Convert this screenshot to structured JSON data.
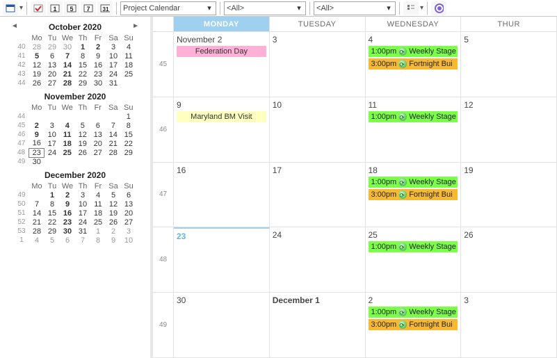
{
  "toolbar": {
    "calendar_combo": "Project Calendar",
    "filter1": "<All>",
    "filter2": "<All>"
  },
  "mini_calendars": [
    {
      "title": "October 2020",
      "show_nav": true,
      "dow": [
        "Mo",
        "Tu",
        "We",
        "Th",
        "Fr",
        "Sa",
        "Su"
      ],
      "weeks": [
        {
          "wk": "40",
          "days": [
            {
              "n": "28",
              "dim": true
            },
            {
              "n": "29",
              "dim": true
            },
            {
              "n": "30",
              "dim": true
            },
            {
              "n": "1",
              "bold": true
            },
            {
              "n": "2",
              "bold": true
            },
            {
              "n": "3"
            },
            {
              "n": "4"
            }
          ]
        },
        {
          "wk": "41",
          "days": [
            {
              "n": "5",
              "bold": true
            },
            {
              "n": "6"
            },
            {
              "n": "7",
              "bold": true
            },
            {
              "n": "8"
            },
            {
              "n": "9"
            },
            {
              "n": "10"
            },
            {
              "n": "11"
            }
          ]
        },
        {
          "wk": "42",
          "days": [
            {
              "n": "12"
            },
            {
              "n": "13"
            },
            {
              "n": "14",
              "bold": true
            },
            {
              "n": "15"
            },
            {
              "n": "16"
            },
            {
              "n": "17"
            },
            {
              "n": "18"
            }
          ]
        },
        {
          "wk": "43",
          "days": [
            {
              "n": "19"
            },
            {
              "n": "20"
            },
            {
              "n": "21",
              "bold": true
            },
            {
              "n": "22"
            },
            {
              "n": "23"
            },
            {
              "n": "24"
            },
            {
              "n": "25"
            }
          ]
        },
        {
          "wk": "44",
          "days": [
            {
              "n": "26"
            },
            {
              "n": "27"
            },
            {
              "n": "28",
              "bold": true
            },
            {
              "n": "29"
            },
            {
              "n": "30"
            },
            {
              "n": "31"
            },
            {
              "n": ""
            }
          ]
        }
      ]
    },
    {
      "title": "November 2020",
      "show_nav": false,
      "dow": [
        "Mo",
        "Tu",
        "We",
        "Th",
        "Fr",
        "Sa",
        "Su"
      ],
      "weeks": [
        {
          "wk": "44",
          "days": [
            {
              "n": ""
            },
            {
              "n": ""
            },
            {
              "n": ""
            },
            {
              "n": ""
            },
            {
              "n": ""
            },
            {
              "n": ""
            },
            {
              "n": "1"
            }
          ]
        },
        {
          "wk": "45",
          "days": [
            {
              "n": "2",
              "bold": true
            },
            {
              "n": "3"
            },
            {
              "n": "4",
              "bold": true
            },
            {
              "n": "5"
            },
            {
              "n": "6"
            },
            {
              "n": "7"
            },
            {
              "n": "8"
            }
          ]
        },
        {
          "wk": "46",
          "days": [
            {
              "n": "9",
              "bold": true
            },
            {
              "n": "10"
            },
            {
              "n": "11",
              "bold": true
            },
            {
              "n": "12"
            },
            {
              "n": "13"
            },
            {
              "n": "14"
            },
            {
              "n": "15"
            }
          ]
        },
        {
          "wk": "47",
          "days": [
            {
              "n": "16"
            },
            {
              "n": "17"
            },
            {
              "n": "18",
              "bold": true
            },
            {
              "n": "19"
            },
            {
              "n": "20"
            },
            {
              "n": "21"
            },
            {
              "n": "22"
            }
          ]
        },
        {
          "wk": "48",
          "days": [
            {
              "n": "23",
              "today": true
            },
            {
              "n": "24"
            },
            {
              "n": "25",
              "bold": true
            },
            {
              "n": "26"
            },
            {
              "n": "27"
            },
            {
              "n": "28"
            },
            {
              "n": "29"
            }
          ]
        },
        {
          "wk": "49",
          "days": [
            {
              "n": "30"
            },
            {
              "n": ""
            },
            {
              "n": ""
            },
            {
              "n": ""
            },
            {
              "n": ""
            },
            {
              "n": ""
            },
            {
              "n": ""
            }
          ]
        }
      ]
    },
    {
      "title": "December 2020",
      "show_nav": false,
      "dow": [
        "Mo",
        "Tu",
        "We",
        "Th",
        "Fr",
        "Sa",
        "Su"
      ],
      "weeks": [
        {
          "wk": "49",
          "days": [
            {
              "n": ""
            },
            {
              "n": "1",
              "bold": true
            },
            {
              "n": "2",
              "bold": true
            },
            {
              "n": "3"
            },
            {
              "n": "4"
            },
            {
              "n": "5"
            },
            {
              "n": "6"
            }
          ]
        },
        {
          "wk": "50",
          "days": [
            {
              "n": "7"
            },
            {
              "n": "8"
            },
            {
              "n": "9",
              "bold": true
            },
            {
              "n": "10"
            },
            {
              "n": "11"
            },
            {
              "n": "12"
            },
            {
              "n": "13"
            }
          ]
        },
        {
          "wk": "51",
          "days": [
            {
              "n": "14"
            },
            {
              "n": "15"
            },
            {
              "n": "16",
              "bold": true
            },
            {
              "n": "17"
            },
            {
              "n": "18"
            },
            {
              "n": "19"
            },
            {
              "n": "20"
            }
          ]
        },
        {
          "wk": "52",
          "days": [
            {
              "n": "21"
            },
            {
              "n": "22"
            },
            {
              "n": "23",
              "bold": true
            },
            {
              "n": "24"
            },
            {
              "n": "25"
            },
            {
              "n": "26"
            },
            {
              "n": "27"
            }
          ]
        },
        {
          "wk": "53",
          "days": [
            {
              "n": "28"
            },
            {
              "n": "29"
            },
            {
              "n": "30",
              "bold": true
            },
            {
              "n": "31"
            },
            {
              "n": "1",
              "dim": true
            },
            {
              "n": "2",
              "dim": true
            },
            {
              "n": "3",
              "dim": true
            }
          ]
        },
        {
          "wk": "1",
          "days": [
            {
              "n": "4",
              "dim": true
            },
            {
              "n": "5",
              "dim": true
            },
            {
              "n": "6",
              "dim": true
            },
            {
              "n": "7",
              "dim": true
            },
            {
              "n": "8",
              "dim": true
            },
            {
              "n": "9",
              "dim": true
            },
            {
              "n": "10",
              "dim": true
            }
          ]
        }
      ]
    }
  ],
  "day_headers": [
    "MONDAY",
    "TUESDAY",
    "WEDNESDAY",
    "THUR"
  ],
  "selected_day_index": 0,
  "weeks": [
    {
      "wk": "45",
      "cells": [
        {
          "label": "November 2",
          "events": [
            {
              "cls": "pink allday",
              "text": "Federation Day"
            }
          ]
        },
        {
          "label": "3"
        },
        {
          "label": "4",
          "events": [
            {
              "cls": "green",
              "time": "1:00pm",
              "rec": true,
              "text": "Weekly Stage"
            },
            {
              "cls": "orange",
              "time": "3:00pm",
              "rec": true,
              "text": "Fortnight Bui"
            }
          ]
        },
        {
          "label": "5"
        }
      ]
    },
    {
      "wk": "46",
      "cells": [
        {
          "label": "9",
          "events": [
            {
              "cls": "yellow allday",
              "text": "Maryland BM Visit"
            }
          ]
        },
        {
          "label": "10"
        },
        {
          "label": "11",
          "events": [
            {
              "cls": "green",
              "time": "1:00pm",
              "rec": true,
              "text": "Weekly Stage"
            }
          ]
        },
        {
          "label": "12"
        }
      ]
    },
    {
      "wk": "47",
      "cells": [
        {
          "label": "16"
        },
        {
          "label": "17"
        },
        {
          "label": "18",
          "events": [
            {
              "cls": "green",
              "time": "1:00pm",
              "rec": true,
              "text": "Weekly Stage"
            },
            {
              "cls": "orange",
              "time": "3:00pm",
              "rec": true,
              "text": "Fortnight Bui"
            }
          ]
        },
        {
          "label": "19"
        }
      ]
    },
    {
      "wk": "48",
      "sel_idx": 0,
      "cells": [
        {
          "label": "23",
          "sel": true
        },
        {
          "label": "24"
        },
        {
          "label": "25",
          "events": [
            {
              "cls": "green",
              "time": "1:00pm",
              "rec": true,
              "text": "Weekly Stage"
            }
          ]
        },
        {
          "label": "26"
        }
      ]
    },
    {
      "wk": "49",
      "cells": [
        {
          "label": "30"
        },
        {
          "label": "December 1",
          "bold": true
        },
        {
          "label": "2",
          "events": [
            {
              "cls": "green",
              "time": "1:00pm",
              "rec": true,
              "text": "Weekly Stage"
            },
            {
              "cls": "orange",
              "time": "3:00pm",
              "rec": true,
              "text": "Fortnight Bui"
            }
          ]
        },
        {
          "label": "3"
        }
      ]
    }
  ]
}
